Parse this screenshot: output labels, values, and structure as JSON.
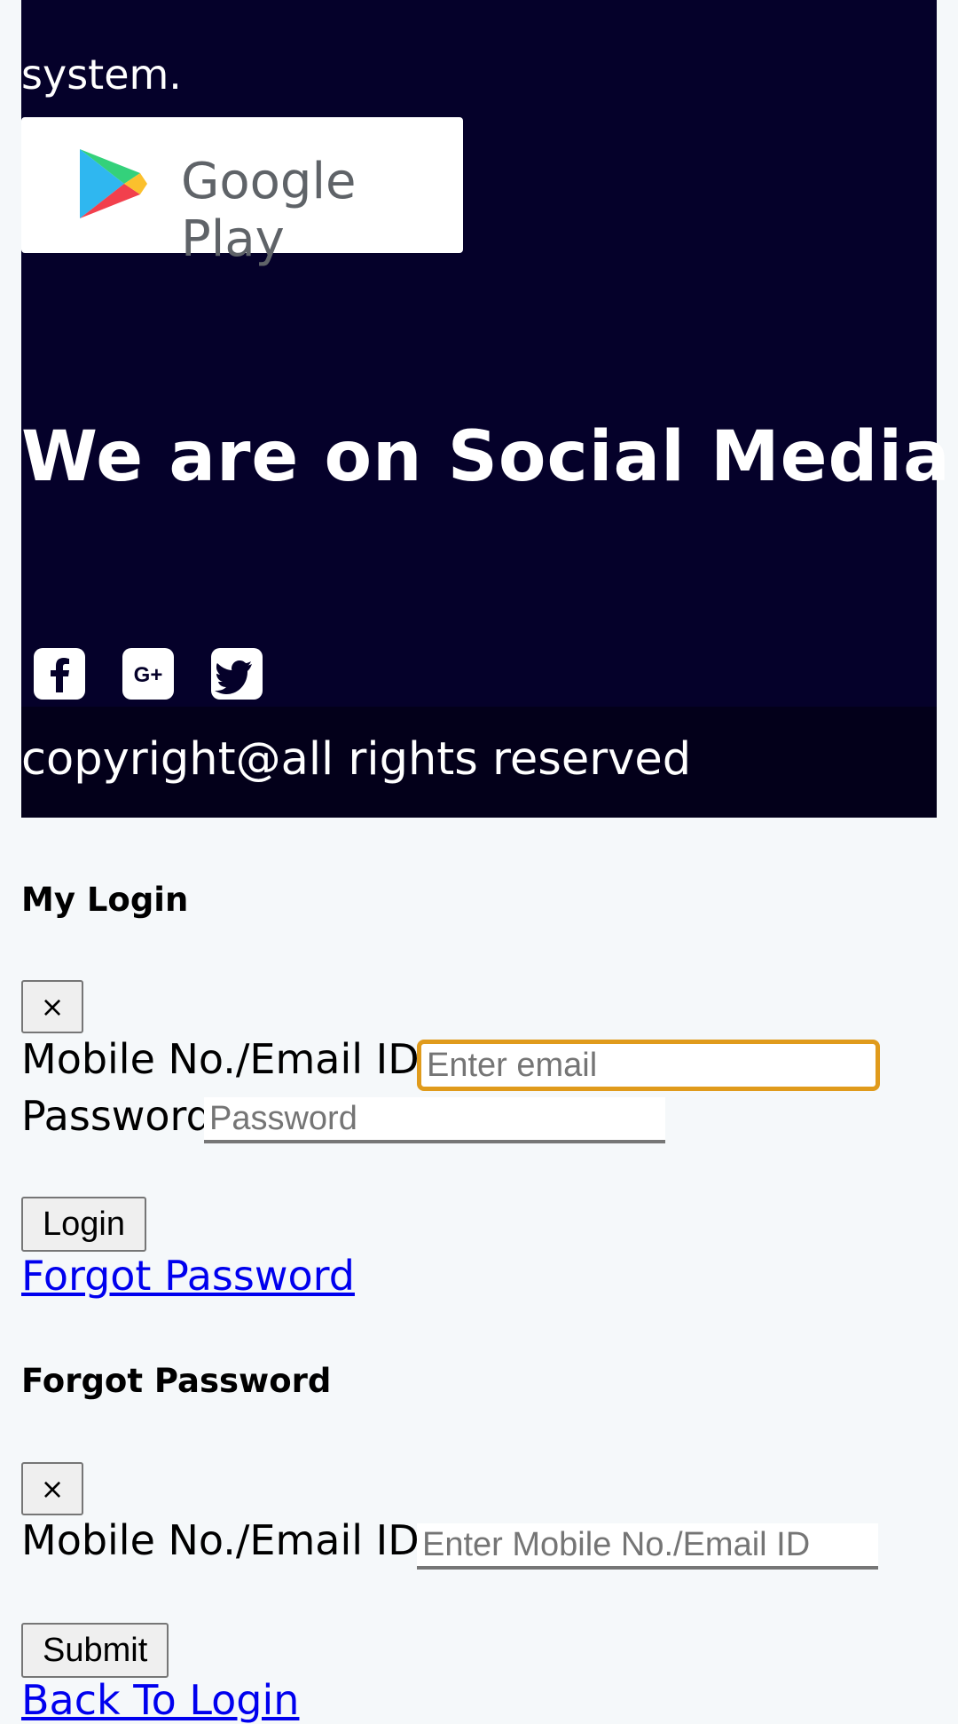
{
  "footer": {
    "description_tail": "system.",
    "google_play": {
      "label": "Google Play",
      "icon": "google-play-icon"
    },
    "social_heading": "We are on Social Media",
    "social_icons": [
      {
        "name": "facebook-icon"
      },
      {
        "name": "google-plus-icon"
      },
      {
        "name": "twitter-icon"
      }
    ],
    "copyright": "copyright@all rights reserved",
    "colors": {
      "background": "#05012a",
      "copyright_bar": "#03001a",
      "text": "#ffffff"
    }
  },
  "login_modal": {
    "title": "My Login",
    "close_label": "×",
    "email_label": "Mobile No./Email ID",
    "email_placeholder": "Enter email",
    "password_label": "Password",
    "password_placeholder": "Password",
    "login_button": "Login",
    "forgot_link": "Forgot Password"
  },
  "forgot_modal": {
    "title": "Forgot Password",
    "close_label": "×",
    "email_label": "Mobile No./Email ID",
    "email_placeholder": "Enter Mobile No./Email ID",
    "submit_button": "Submit",
    "back_link": "Back To Login"
  },
  "colors": {
    "page_background": "#f5f8fa",
    "link": "#0000ee",
    "focus_ring": "#e09b1c"
  }
}
